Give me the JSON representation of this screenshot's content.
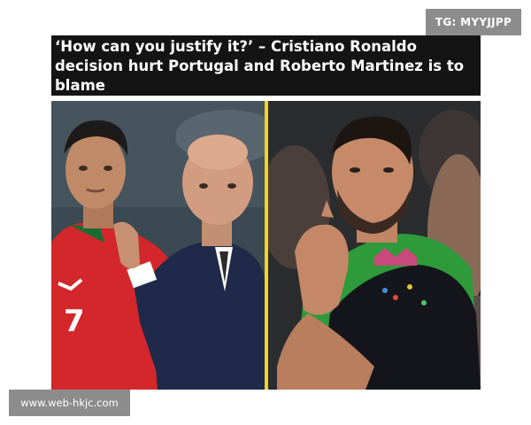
{
  "badge": {
    "text": "TG: MYYJJPP"
  },
  "article": {
    "headline": "‘How can you justify it?’ – Cristiano Ronaldo decision hurt Portugal and Roberto Martinez is to blame"
  },
  "images": {
    "left": {
      "jersey_number": "7"
    },
    "right": {}
  },
  "colors": {
    "divider": "#f2d321",
    "portugal_red": "#d3272b",
    "pitch_green": "#2f9a3a"
  },
  "footer": {
    "site": "www.web-hkjc.com"
  }
}
